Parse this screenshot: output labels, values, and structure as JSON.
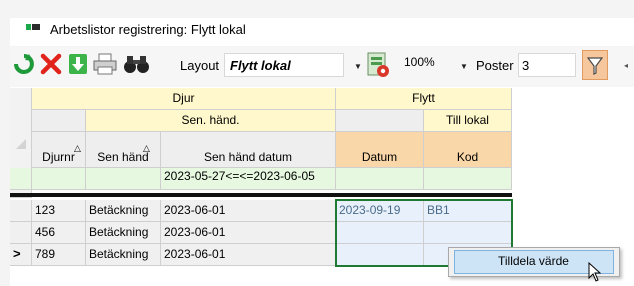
{
  "window": {
    "title": "Arbetslistor registrering: Flytt lokal"
  },
  "toolbar": {
    "refresh_icon": "refresh-icon",
    "delete_icon": "delete-icon",
    "export_icon": "download-icon",
    "print_icon": "printer-icon",
    "search_icon": "binoculars-icon",
    "layout_label": "Layout",
    "layout_value": "Flytt lokal",
    "layout_settings_icon": "layout-settings-icon",
    "zoom_value": "100%",
    "poster_label": "Poster",
    "poster_value": "3",
    "filter_icon": "filter-icon"
  },
  "grid": {
    "group_headers": [
      "Djur",
      "Flytt"
    ],
    "sub_headers": [
      "Sen. händ.",
      "Till lokal"
    ],
    "columns": [
      "Djurnr",
      "Sen händ",
      "Sen händ datum",
      "Datum",
      "Kod"
    ],
    "filter_row": [
      "",
      "",
      "2023-05-27<=<=2023-06-05",
      "",
      ""
    ],
    "rows": [
      {
        "indicator": "",
        "cells": [
          "123",
          "Betäckning",
          "2023-06-01",
          "2023-09-19",
          "BB1"
        ]
      },
      {
        "indicator": "",
        "cells": [
          "456",
          "Betäckning",
          "2023-06-01",
          "",
          ""
        ]
      },
      {
        "indicator": ">",
        "cells": [
          "789",
          "Betäckning",
          "2023-06-01",
          "",
          ""
        ]
      }
    ]
  },
  "context_menu": {
    "items": [
      "Tilldela värde"
    ]
  },
  "colors": {
    "header_yellow": "#fff8cc",
    "header_orange": "#f9d7a8",
    "filter_green": "#e7f8e1",
    "selection_border": "#1e7a32",
    "filter_button": "#f6c79c"
  }
}
